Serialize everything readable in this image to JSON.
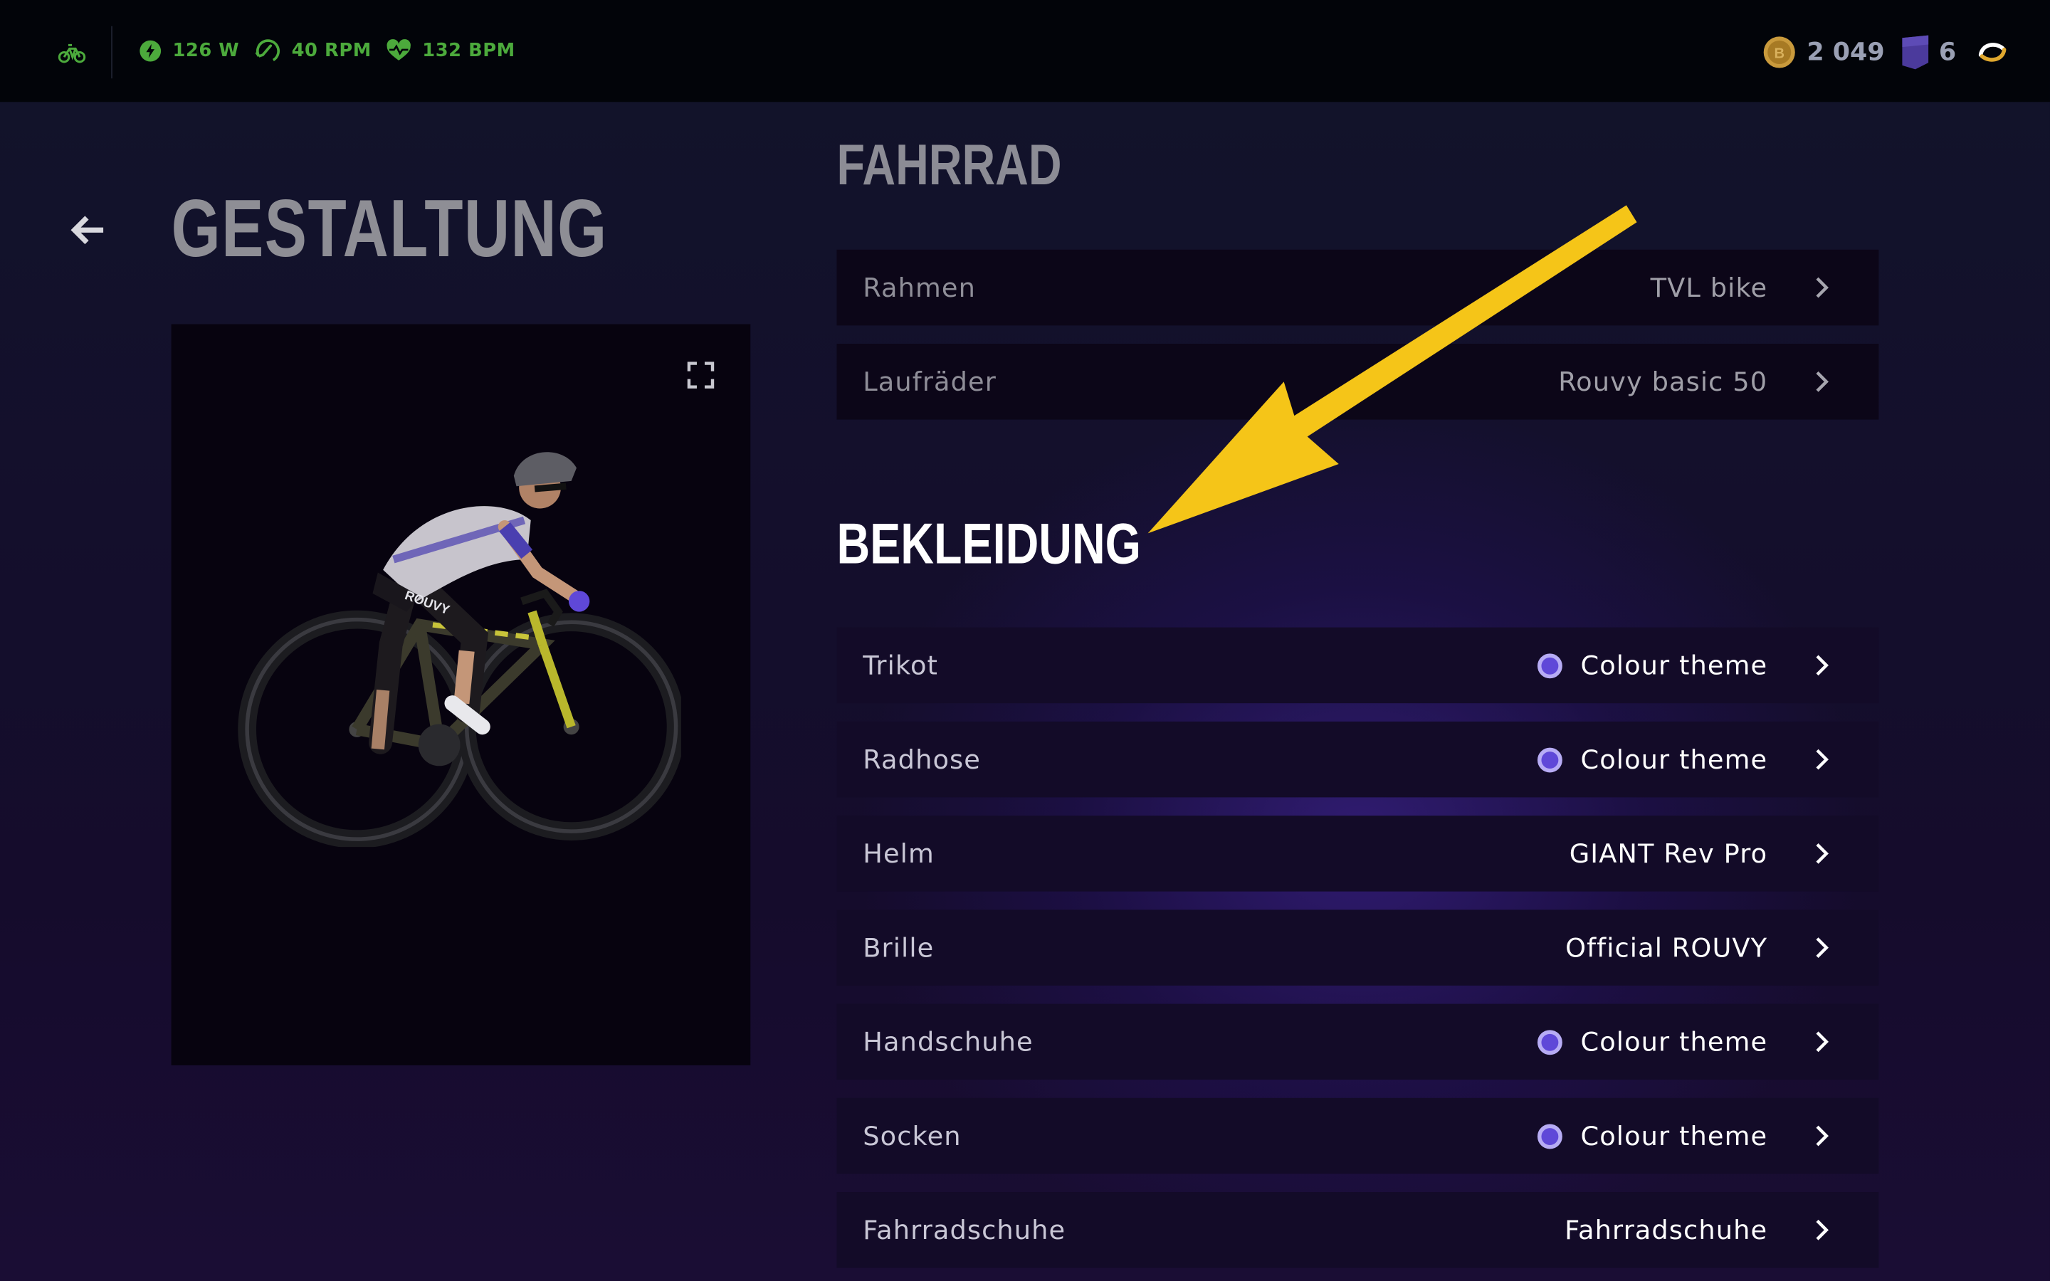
{
  "topbar": {
    "bike_icon": "bike-icon",
    "metrics": [
      {
        "icon": "power-icon",
        "label": "126 W"
      },
      {
        "icon": "cadence-icon",
        "label": "40 RPM"
      },
      {
        "icon": "heart-rate-icon",
        "label": "132 BPM"
      }
    ],
    "coins": "2 049",
    "badge": "6",
    "accent_green": "#4caa3c"
  },
  "page": {
    "title": "GESTALTUNG"
  },
  "sections": {
    "fahrrad_title": "FAHRRAD",
    "bekleidung_title": "BEKLEIDUNG"
  },
  "fahrrad": [
    {
      "label": "Rahmen",
      "value": "TVL bike"
    },
    {
      "label": "Laufräder",
      "value": "Rouvy basic 50"
    }
  ],
  "bekleidung": [
    {
      "label": "Trikot",
      "value": "Colour theme",
      "swatch": "#5f48d8"
    },
    {
      "label": "Radhose",
      "value": "Colour theme",
      "swatch": "#5f48d8"
    },
    {
      "label": "Helm",
      "value": "GIANT Rev Pro"
    },
    {
      "label": "Brille",
      "value": "Official ROUVY"
    },
    {
      "label": "Handschuhe",
      "value": "Colour theme",
      "swatch": "#5f48d8"
    },
    {
      "label": "Socken",
      "value": "Colour theme",
      "swatch": "#5f48d8"
    },
    {
      "label": "Fahrradschuhe",
      "value": "Fahrradschuhe"
    }
  ],
  "annotation_arrow_color": "#f5c518"
}
